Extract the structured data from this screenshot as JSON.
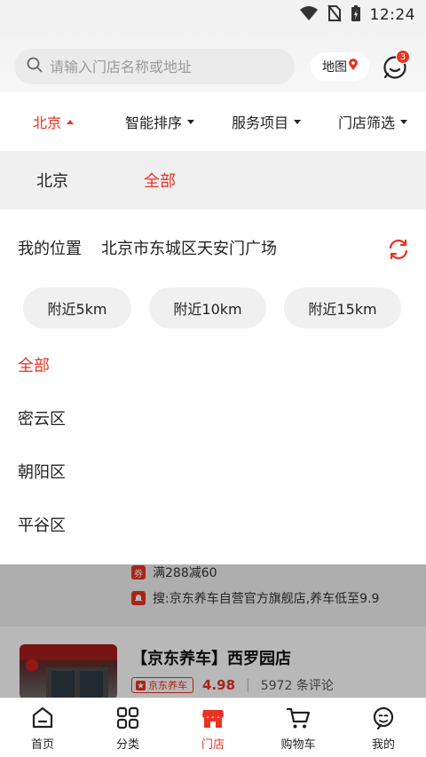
{
  "status_bar": {
    "time": "12:24",
    "icons": [
      "wifi-icon",
      "no-sim-icon",
      "battery-charging-icon"
    ]
  },
  "search": {
    "placeholder": "请输入门店名称或地址",
    "map_label": "地图",
    "message_badge": "3"
  },
  "filters": [
    {
      "label": "北京",
      "active": true
    },
    {
      "label": "智能排序",
      "active": false
    },
    {
      "label": "服务项目",
      "active": false
    },
    {
      "label": "门店筛选",
      "active": false
    }
  ],
  "region": {
    "city": "北京",
    "all_label": "全部"
  },
  "location": {
    "label": "我的位置",
    "address": "北京市东城区天安门广场"
  },
  "distances": [
    "附近5km",
    "附近10km",
    "附近15km"
  ],
  "districts": [
    {
      "label": "全部",
      "active": true
    },
    {
      "label": "密云区",
      "active": false
    },
    {
      "label": "朝阳区",
      "active": false
    },
    {
      "label": "平谷区",
      "active": false
    }
  ],
  "store_list": {
    "promo_coupon_tag": "券",
    "promo_coupon": "满288减60",
    "promo_search": "搜:京东养车自营官方旗舰店,养车低至9.9",
    "store_name": "【京东养车】西罗园店",
    "brand_tag": "京东养车",
    "rating": "4.98",
    "reviews": "5972 条评论"
  },
  "nav": [
    {
      "label": "首页",
      "icon": "home-icon",
      "active": false
    },
    {
      "label": "分类",
      "icon": "category-icon",
      "active": false
    },
    {
      "label": "门店",
      "icon": "store-icon",
      "active": true
    },
    {
      "label": "购物车",
      "icon": "cart-icon",
      "active": false
    },
    {
      "label": "我的",
      "icon": "profile-icon",
      "active": false
    }
  ],
  "colors": {
    "accent": "#e93323",
    "text": "#222222",
    "chip_bg": "#f0f0f0"
  }
}
